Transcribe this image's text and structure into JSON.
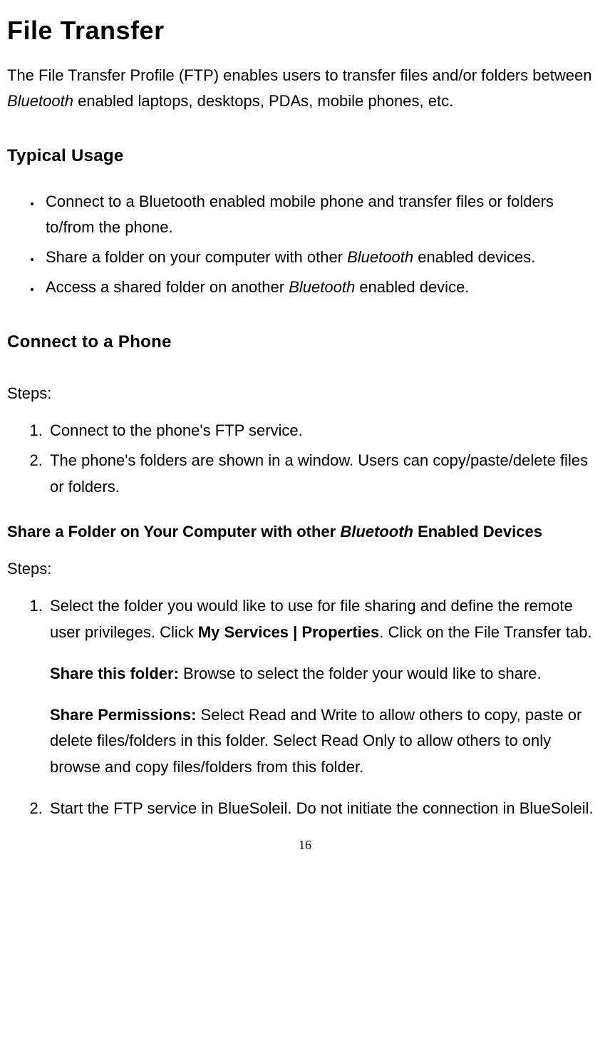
{
  "title": "File Transfer",
  "intro_parts": [
    "The File Transfer Profile (FTP) enables users to transfer files and/or folders between ",
    "Bluetooth",
    " enabled laptops, desktops, PDAs, mobile phones, etc."
  ],
  "section_typical": "Typical Usage",
  "typical_items": [
    {
      "plain": "Connect to a Bluetooth enabled mobile phone and transfer files or folders to/from the phone."
    },
    {
      "parts": [
        "Share a folder on your computer with other ",
        "Bluetooth",
        " enabled devices."
      ]
    },
    {
      "parts": [
        "Access a shared folder on another ",
        "Bluetooth",
        " enabled device."
      ]
    }
  ],
  "section_connect": "Connect to a Phone",
  "steps_label": "Steps:",
  "connect_steps": [
    "Connect to the phone's FTP service.",
    "The phone's folders are shown in a window. Users can copy/paste/delete files or folders."
  ],
  "share_heading_parts": [
    "Share a Folder on Your Computer with other ",
    "Bluetooth",
    " Enabled Devices"
  ],
  "share_step1_parts": [
    "Select the folder you would like to use for file sharing and define the remote user privileges. Click ",
    "My Services | Properties",
    ". Click on the File Transfer tab."
  ],
  "share_this_label": "Share this folder:",
  "share_this_text": " Browse to select the folder your would like to share.",
  "share_perm_label": "Share Permissions:",
  "share_perm_text": " Select Read and Write to allow others to copy, paste or delete files/folders in this folder. Select Read Only to allow others to only browse and copy files/folders from this folder.",
  "share_step2": "Start the FTP service in BlueSoleil. Do not initiate the connection in BlueSoleil.",
  "page_number": "16"
}
